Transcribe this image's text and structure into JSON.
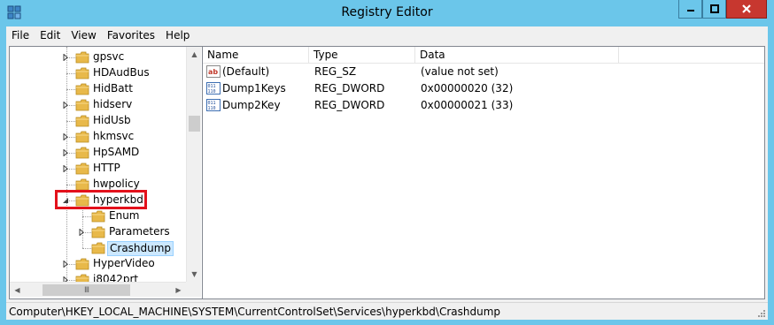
{
  "window": {
    "title": "Registry Editor"
  },
  "menu": [
    "File",
    "Edit",
    "View",
    "Favorites",
    "Help"
  ],
  "tree": {
    "nodes": [
      {
        "label": "gpsvc",
        "expandable": true
      },
      {
        "label": "HDAudBus",
        "expandable": false
      },
      {
        "label": "HidBatt",
        "expandable": false
      },
      {
        "label": "hidserv",
        "expandable": true
      },
      {
        "label": "HidUsb",
        "expandable": false
      },
      {
        "label": "hkmsvc",
        "expandable": true
      },
      {
        "label": "HpSAMD",
        "expandable": true
      },
      {
        "label": "HTTP",
        "expandable": true
      },
      {
        "label": "hwpolicy",
        "expandable": false
      },
      {
        "label": "hyperkbd",
        "expandable": true,
        "expanded": true
      },
      {
        "label": "Enum",
        "expandable": false,
        "child": true
      },
      {
        "label": "Parameters",
        "expandable": true,
        "child": true
      },
      {
        "label": "Crashdump",
        "expandable": false,
        "child": true,
        "selected": true
      },
      {
        "label": "HyperVideo",
        "expandable": true
      },
      {
        "label": "i8042prt",
        "expandable": true
      }
    ],
    "hscroll_thumb_glyph": "III"
  },
  "list": {
    "columns": [
      "Name",
      "Type",
      "Data"
    ],
    "rows": [
      {
        "icon": "string-value-icon",
        "name": "(Default)",
        "type": "REG_SZ",
        "data": "(value not set)"
      },
      {
        "icon": "dword-value-icon",
        "name": "Dump1Keys",
        "type": "REG_DWORD",
        "data": "0x00000020 (32)"
      },
      {
        "icon": "dword-value-icon",
        "name": "Dump2Key",
        "type": "REG_DWORD",
        "data": "0x00000021 (33)"
      }
    ]
  },
  "status": {
    "path": "Computer\\HKEY_LOCAL_MACHINE\\SYSTEM\\CurrentControlSet\\Services\\hyperkbd\\Crashdump"
  },
  "colors": {
    "title_bar": "#6bc6ea",
    "close_button": "#c7372f",
    "highlight_box": "#e3111b",
    "selection": "#cce8ff"
  }
}
